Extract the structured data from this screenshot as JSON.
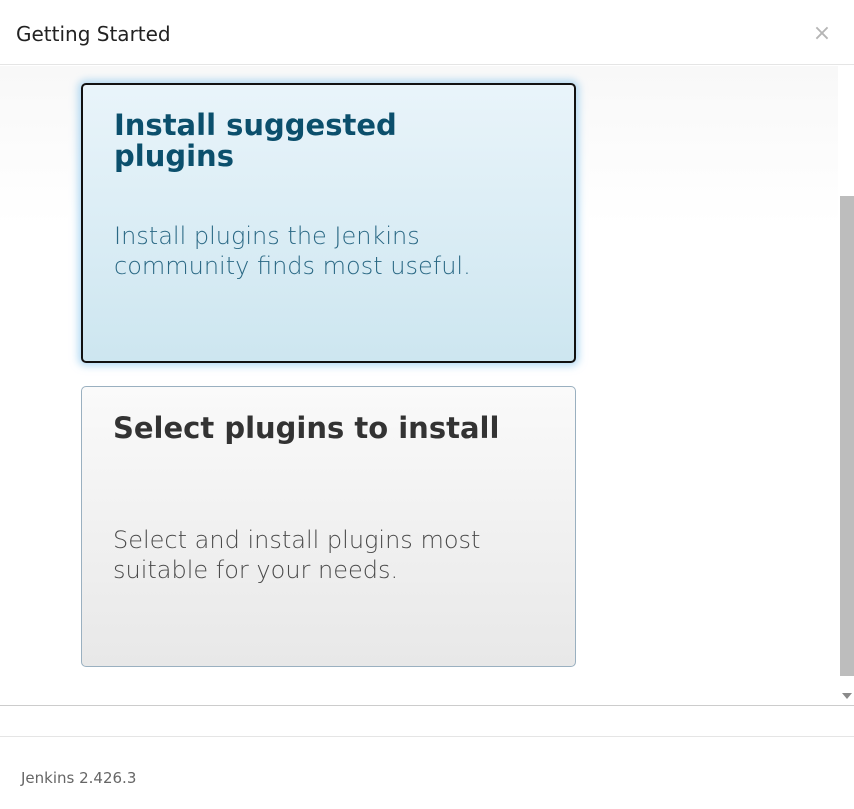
{
  "header": {
    "title": "Getting Started",
    "close_label": "×"
  },
  "options": [
    {
      "title": "Install suggested plugins",
      "description": "Install plugins the Jenkins community finds most useful."
    },
    {
      "title": "Select plugins to install",
      "description": "Select and install plugins most suitable for your needs."
    }
  ],
  "footer": {
    "version": "Jenkins 2.426.3"
  },
  "icons": {
    "close": "close-icon",
    "scroll_down": "chevron-down-icon"
  },
  "colors": {
    "selected_title": "#0b4f6c",
    "selected_text": "#2a6884",
    "selected_border": "#111111",
    "glow": "#78bee8"
  }
}
